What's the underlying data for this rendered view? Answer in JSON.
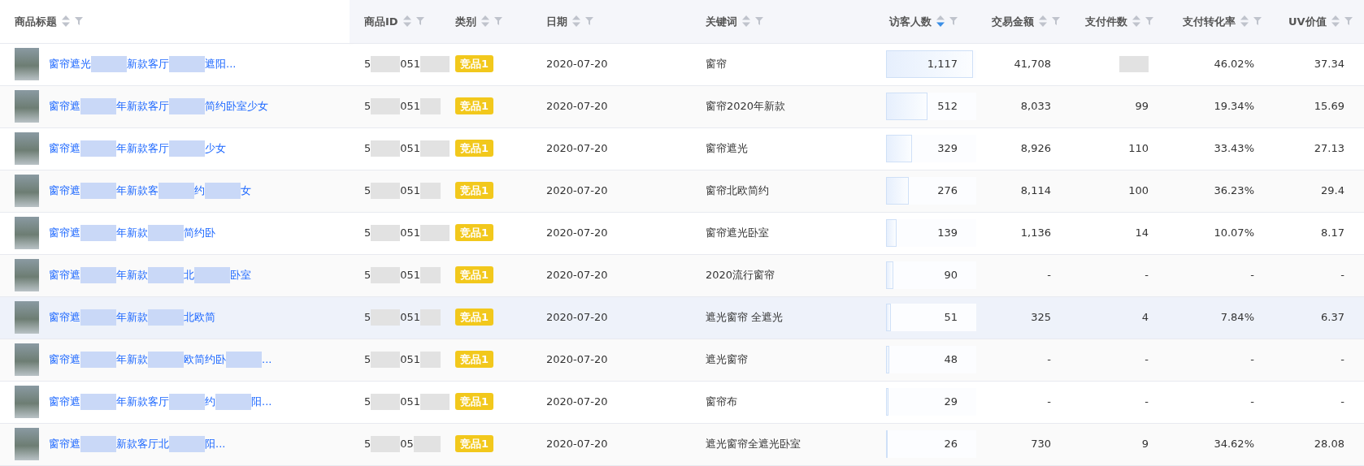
{
  "table": {
    "columns": [
      {
        "label": "商品标题",
        "sorted_descending": false
      },
      {
        "label": "商品ID",
        "sorted_descending": false
      },
      {
        "label": "类别",
        "sorted_descending": false
      },
      {
        "label": "日期",
        "sorted_descending": false
      },
      {
        "label": "关键词",
        "sorted_descending": false
      },
      {
        "label": "访客人数",
        "sorted_descending": true
      },
      {
        "label": "交易金额",
        "sorted_descending": false
      },
      {
        "label": "支付件数",
        "sorted_descending": false
      },
      {
        "label": "支付转化率",
        "sorted_descending": false
      },
      {
        "label": "UV价值",
        "sorted_descending": false
      }
    ],
    "rows": [
      {
        "title_parts": [
          "窗帘遮光",
          "新款客厅",
          "遮阳..."
        ],
        "id_parts": [
          "5",
          "051"
        ],
        "category": "竞品1",
        "date": "2020-07-20",
        "keyword": "窗帘",
        "visitors": "1,117",
        "level": 0.96,
        "amount": "41,708",
        "count": null,
        "rate": "46.02%",
        "uv": "37.34",
        "hovered": false
      },
      {
        "title_parts": [
          "窗帘遮",
          "年新款客厅",
          "简约卧室少女"
        ],
        "id_parts": [
          "5",
          "051"
        ],
        "category": "竞品1",
        "date": "2020-07-20",
        "keyword": "窗帘2020年新款",
        "visitors": "512",
        "level": 0.46,
        "amount": "8,033",
        "count": "99",
        "rate": "19.34%",
        "uv": "15.69",
        "hovered": false
      },
      {
        "title_parts": [
          "窗帘遮",
          "年新款客厅",
          "少女"
        ],
        "id_parts": [
          "5",
          "051"
        ],
        "category": "竞品1",
        "date": "2020-07-20",
        "keyword": "窗帘遮光",
        "visitors": "329",
        "level": 0.29,
        "amount": "8,926",
        "count": "110",
        "rate": "33.43%",
        "uv": "27.13",
        "hovered": false
      },
      {
        "title_parts": [
          "窗帘遮",
          "年新款客",
          "约",
          "女"
        ],
        "id_parts": [
          "5",
          "051"
        ],
        "category": "竞品1",
        "date": "2020-07-20",
        "keyword": "窗帘北欧简约",
        "visitors": "276",
        "level": 0.25,
        "amount": "8,114",
        "count": "100",
        "rate": "36.23%",
        "uv": "29.4",
        "hovered": false
      },
      {
        "title_parts": [
          "窗帘遮",
          "年新款",
          "简约卧"
        ],
        "id_parts": [
          "5",
          "051"
        ],
        "category": "竞品1",
        "date": "2020-07-20",
        "keyword": "窗帘遮光卧室",
        "visitors": "139",
        "level": 0.12,
        "amount": "1,136",
        "count": "14",
        "rate": "10.07%",
        "uv": "8.17",
        "hovered": false
      },
      {
        "title_parts": [
          "窗帘遮",
          "年新款",
          "北",
          "卧室"
        ],
        "id_parts": [
          "5",
          "051"
        ],
        "category": "竞品1",
        "date": "2020-07-20",
        "keyword": "2020流行窗帘",
        "visitors": "90",
        "level": 0.08,
        "amount": "-",
        "count": "-",
        "rate": "-",
        "uv": "-",
        "hovered": false
      },
      {
        "title_parts": [
          "窗帘遮",
          "年新款",
          "北欧简"
        ],
        "id_parts": [
          "5",
          "051"
        ],
        "category": "竞品1",
        "date": "2020-07-20",
        "keyword": "遮光窗帘 全遮光",
        "visitors": "51",
        "level": 0.05,
        "amount": "325",
        "count": "4",
        "rate": "7.84%",
        "uv": "6.37",
        "hovered": true
      },
      {
        "title_parts": [
          "窗帘遮",
          "年新款",
          "欧简约卧",
          "..."
        ],
        "id_parts": [
          "5",
          "051"
        ],
        "category": "竞品1",
        "date": "2020-07-20",
        "keyword": "遮光窗帘",
        "visitors": "48",
        "level": 0.04,
        "amount": "-",
        "count": "-",
        "rate": "-",
        "uv": "-",
        "hovered": false
      },
      {
        "title_parts": [
          "窗帘遮",
          "年新款客厅",
          "约",
          "阳..."
        ],
        "id_parts": [
          "5",
          "051"
        ],
        "category": "竞品1",
        "date": "2020-07-20",
        "keyword": "窗帘布",
        "visitors": "29",
        "level": 0.03,
        "amount": "-",
        "count": "-",
        "rate": "-",
        "uv": "-",
        "hovered": false
      },
      {
        "title_parts": [
          "窗帘遮",
          "新款客厅北",
          "阳..."
        ],
        "id_parts": [
          "5",
          "05"
        ],
        "category": "竞品1",
        "date": "2020-07-20",
        "keyword": "遮光窗帘全遮光卧室",
        "visitors": "26",
        "level": 0.02,
        "amount": "730",
        "count": "9",
        "rate": "34.62%",
        "uv": "28.08",
        "hovered": false
      }
    ]
  }
}
